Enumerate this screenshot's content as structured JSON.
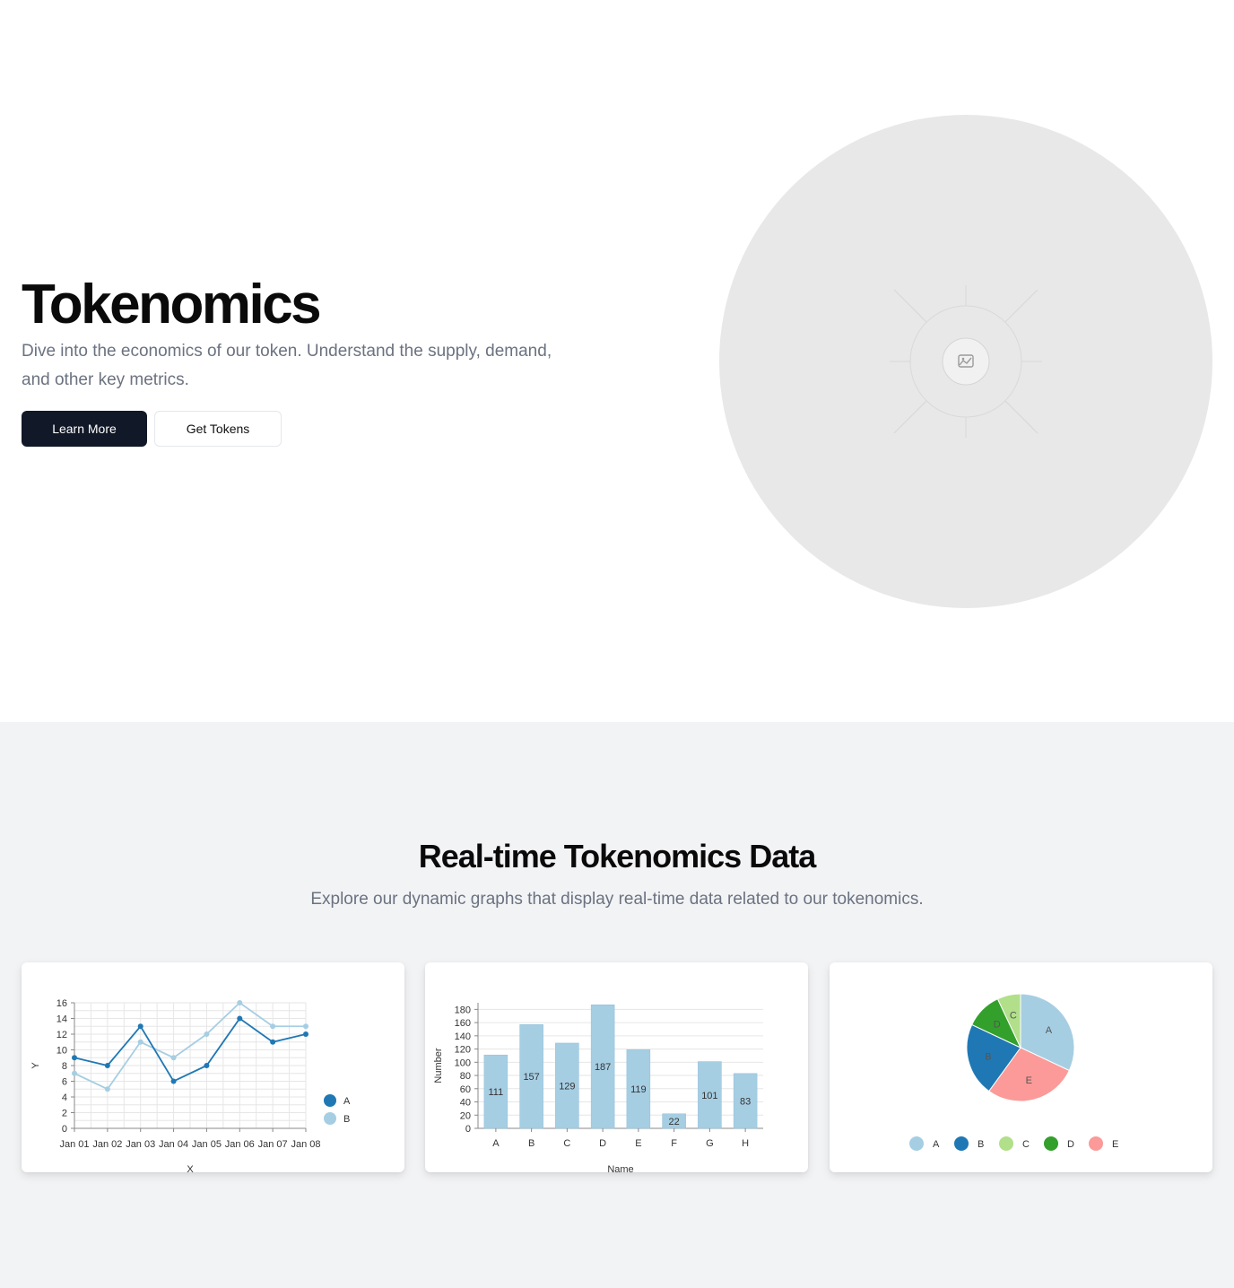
{
  "hero": {
    "title": "Tokenomics",
    "subtitle": "Dive into the economics of our token. Understand the supply, demand, and other key metrics.",
    "primary_button": "Learn More",
    "secondary_button": "Get Tokens",
    "image_icon": "image-placeholder-icon"
  },
  "section": {
    "title": "Real-time Tokenomics Data",
    "subtitle": "Explore our dynamic graphs that display real-time data related to our tokenomics."
  },
  "colors": {
    "primary_button_bg": "#111827",
    "series_a": "#1f78b4",
    "series_b": "#a6cee3",
    "pie_c": "#b2df8a",
    "pie_d": "#33a02c",
    "pie_e": "#fb9a99"
  },
  "chart_data": [
    {
      "type": "line",
      "x": [
        "Jan 01",
        "Jan 02",
        "Jan 03",
        "Jan 04",
        "Jan 05",
        "Jan 06",
        "Jan 07",
        "Jan 08"
      ],
      "series": [
        {
          "name": "A",
          "values": [
            9,
            8,
            13,
            6,
            8,
            14,
            11,
            12
          ]
        },
        {
          "name": "B",
          "values": [
            7,
            5,
            11,
            9,
            12,
            16,
            13,
            13
          ]
        }
      ],
      "xlabel": "X",
      "ylabel": "Y",
      "ylim": [
        0,
        16
      ],
      "yticks": [
        0,
        2,
        4,
        6,
        8,
        10,
        12,
        14,
        16
      ],
      "grid": true,
      "legend": "right"
    },
    {
      "type": "bar",
      "categories": [
        "A",
        "B",
        "C",
        "D",
        "E",
        "F",
        "G",
        "H"
      ],
      "values": [
        111,
        157,
        129,
        187,
        119,
        22,
        101,
        83
      ],
      "xlabel": "Name",
      "ylabel": "Number",
      "ylim": [
        0,
        190
      ],
      "yticks": [
        0,
        20,
        40,
        60,
        80,
        100,
        120,
        140,
        160,
        180
      ],
      "grid": true
    },
    {
      "type": "pie",
      "labels": [
        "A",
        "B",
        "C",
        "D",
        "E"
      ],
      "values": [
        32,
        22,
        7,
        11,
        28
      ],
      "legend": "bottom"
    }
  ]
}
